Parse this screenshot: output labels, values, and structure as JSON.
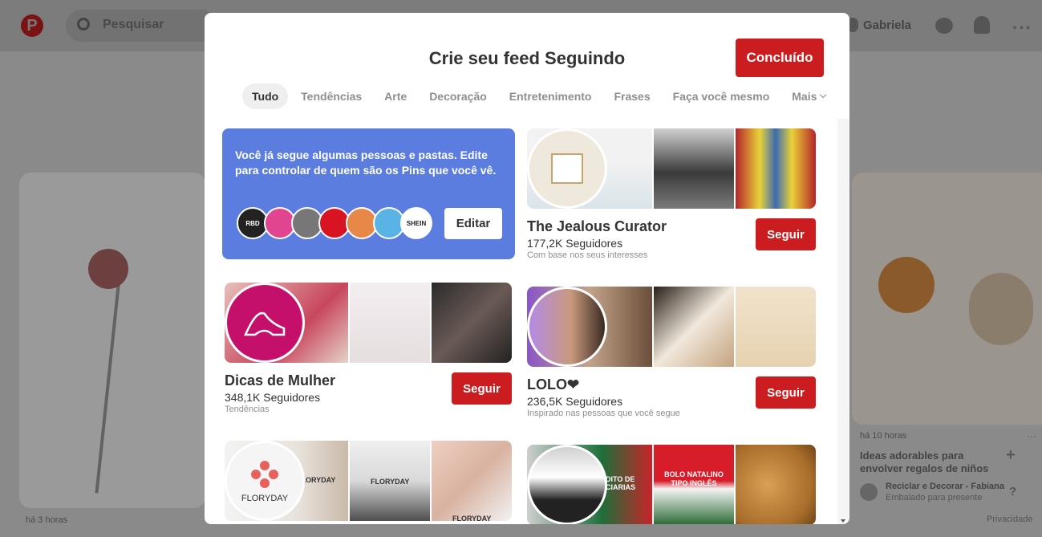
{
  "background": {
    "search_placeholder": "Pesquisar",
    "user_name": "Gabriela",
    "left_pin_time": "há 3 horas",
    "right_pin_time": "há 10 horas",
    "right_pin_title": "Ideas adorables para envolver regalos de niños",
    "right_pin_source": "Reciclar e Decorar - Fabiana",
    "right_pin_source_sub": "Embalado para presente",
    "privacy_link": "Privacidade"
  },
  "modal": {
    "title": "Crie seu feed Seguindo",
    "done_label": "Concluído",
    "tabs": [
      "Tudo",
      "Tendências",
      "Arte",
      "Decoração",
      "Entretenimento",
      "Frases",
      "Faça você mesmo",
      "Mais"
    ],
    "active_tab": "Tudo"
  },
  "info_card": {
    "text": "Você já segue algumas pessoas e pastas. Edite para controlar de quem são os Pins que você vê.",
    "edit_label": "Editar",
    "avatars": [
      "RBD",
      "",
      "",
      "",
      "",
      "",
      "SHEIN"
    ]
  },
  "boards": [
    {
      "name": "The Jealous Curator",
      "followers": "177,2K Seguidores",
      "reason": "Com base nos seus interesses",
      "follow_label": "Seguir"
    },
    {
      "name": "Dicas de Mulher",
      "followers": "348,1K Seguidores",
      "reason": "Tendências",
      "follow_label": "Seguir"
    },
    {
      "name": "LOLO❤",
      "followers": "236,5K Seguidores",
      "reason": "Inspirado nas pessoas que você segue",
      "follow_label": "Seguir"
    },
    {
      "name": "FLORYDAY",
      "avatar_text": "FLORYDAY",
      "img_labels": [
        "FLORYDAY",
        "FLORYDAY",
        "FLORYDAY"
      ]
    },
    {
      "name": "",
      "img_labels": [
        "DITO DE CIARIAS",
        "BOLO NATALINO TIPO INGLÊS"
      ]
    }
  ],
  "colors": {
    "accent_red": "#cb1c1f",
    "info_blue": "#5b7de0"
  }
}
